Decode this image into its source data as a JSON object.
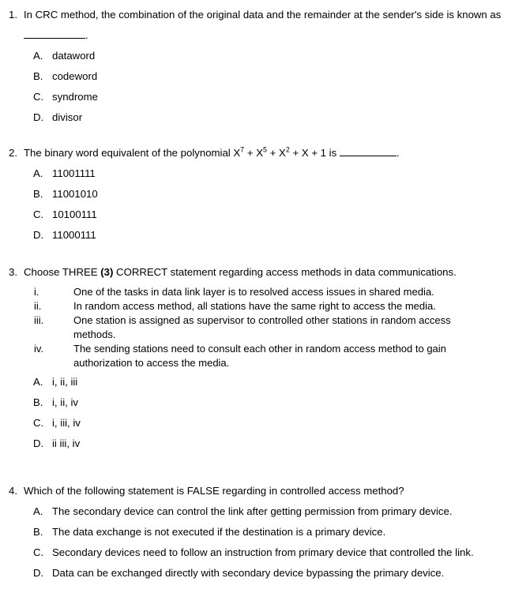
{
  "document": {
    "type": "multiple-choice-exam-questions",
    "questions": [
      {
        "number": "1.",
        "stem_prefix": "In CRC method, the combination of the original data and the remainder at the sender's side is known as",
        "stem_suffix": ".",
        "options": [
          {
            "letter": "A.",
            "text": "dataword"
          },
          {
            "letter": "B.",
            "text": "codeword"
          },
          {
            "letter": "C.",
            "text": "syndrome"
          },
          {
            "letter": "D.",
            "text": "divisor"
          }
        ]
      },
      {
        "number": "2.",
        "stem_part1": "The binary word equivalent of the polynomial X",
        "sup1": "7",
        "stem_part2": " + X",
        "sup2": "5",
        "stem_part3": " + X",
        "sup3": "2",
        "stem_part4": " + X + 1 is",
        "stem_suffix": ".",
        "options": [
          {
            "letter": "A.",
            "text": "11001111"
          },
          {
            "letter": "B.",
            "text": "11001010"
          },
          {
            "letter": "C.",
            "text": "10100111"
          },
          {
            "letter": "D.",
            "text": "11000111"
          }
        ]
      },
      {
        "number": "3.",
        "stem_part1": "Choose THREE ",
        "stem_bold": "(3)",
        "stem_part2": " CORRECT statement regarding access methods in data communications.",
        "statements": [
          {
            "numeral": "i.",
            "text": "One of the tasks in data link layer is to resolved access issues in shared media."
          },
          {
            "numeral": "ii.",
            "text": "In random access method, all stations have the same right to access the media."
          },
          {
            "numeral": "iii.",
            "text": "One station is assigned as supervisor to controlled other stations in random access methods."
          },
          {
            "numeral": "iv.",
            "text": "The sending stations need to consult each other in random access method to gain authorization to access the media."
          }
        ],
        "options": [
          {
            "letter": "A.",
            "text": "i, ii, iii"
          },
          {
            "letter": "B.",
            "text": "i, ii, iv"
          },
          {
            "letter": "C.",
            "text": "i, iii, iv"
          },
          {
            "letter": "D.",
            "text": "ii iii, iv"
          }
        ]
      },
      {
        "number": "4.",
        "stem": "Which of the following statement is FALSE regarding in controlled access method?",
        "options": [
          {
            "letter": "A.",
            "text": "The secondary device can control the link after getting permission from primary device."
          },
          {
            "letter": "B.",
            "text": "The data exchange is not executed if the destination is a primary device."
          },
          {
            "letter": "C.",
            "text": "Secondary devices need to follow an instruction from primary device that controlled the link."
          },
          {
            "letter": "D.",
            "text": "Data can be exchanged directly with secondary device bypassing the primary device."
          }
        ]
      }
    ]
  }
}
